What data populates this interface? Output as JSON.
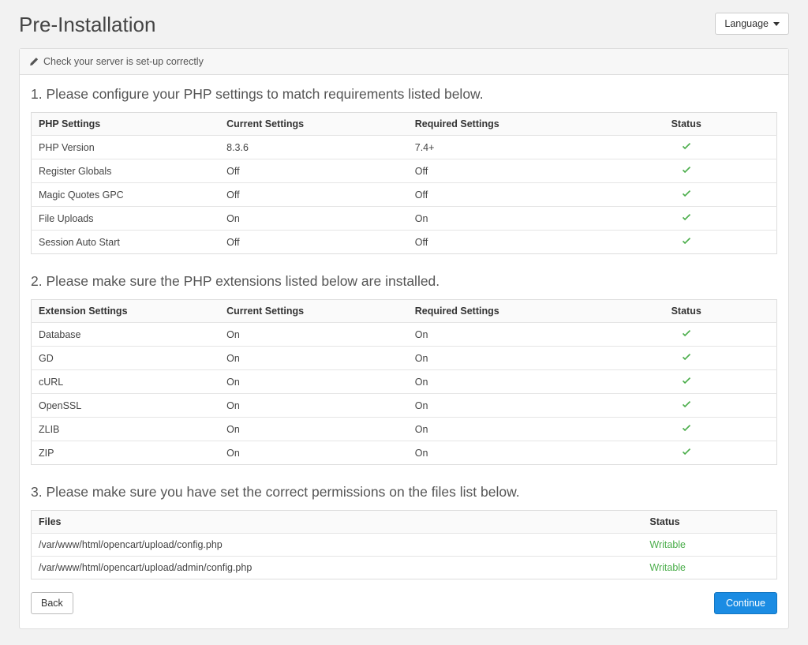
{
  "page_title": "Pre-Installation",
  "language_label": "Language",
  "panel_subtitle": "Check your server is set-up correctly",
  "sections": {
    "php": {
      "title": "1. Please configure your PHP settings to match requirements listed below.",
      "headers": {
        "c0": "PHP Settings",
        "c1": "Current Settings",
        "c2": "Required Settings",
        "c3": "Status"
      },
      "rows": [
        {
          "name": "PHP Version",
          "current": "8.3.6",
          "required": "7.4+",
          "status": "ok"
        },
        {
          "name": "Register Globals",
          "current": "Off",
          "required": "Off",
          "status": "ok"
        },
        {
          "name": "Magic Quotes GPC",
          "current": "Off",
          "required": "Off",
          "status": "ok"
        },
        {
          "name": "File Uploads",
          "current": "On",
          "required": "On",
          "status": "ok"
        },
        {
          "name": "Session Auto Start",
          "current": "Off",
          "required": "Off",
          "status": "ok"
        }
      ]
    },
    "ext": {
      "title": "2. Please make sure the PHP extensions listed below are installed.",
      "headers": {
        "c0": "Extension Settings",
        "c1": "Current Settings",
        "c2": "Required Settings",
        "c3": "Status"
      },
      "rows": [
        {
          "name": "Database",
          "current": "On",
          "required": "On",
          "status": "ok"
        },
        {
          "name": "GD",
          "current": "On",
          "required": "On",
          "status": "ok"
        },
        {
          "name": "cURL",
          "current": "On",
          "required": "On",
          "status": "ok"
        },
        {
          "name": "OpenSSL",
          "current": "On",
          "required": "On",
          "status": "ok"
        },
        {
          "name": "ZLIB",
          "current": "On",
          "required": "On",
          "status": "ok"
        },
        {
          "name": "ZIP",
          "current": "On",
          "required": "On",
          "status": "ok"
        }
      ]
    },
    "files": {
      "title": "3. Please make sure you have set the correct permissions on the files list below.",
      "headers": {
        "c0": "Files",
        "c1": "Status"
      },
      "rows": [
        {
          "path": "/var/www/html/opencart/upload/config.php",
          "status": "Writable"
        },
        {
          "path": "/var/www/html/opencart/upload/admin/config.php",
          "status": "Writable"
        }
      ]
    }
  },
  "buttons": {
    "back": "Back",
    "continue": "Continue"
  }
}
